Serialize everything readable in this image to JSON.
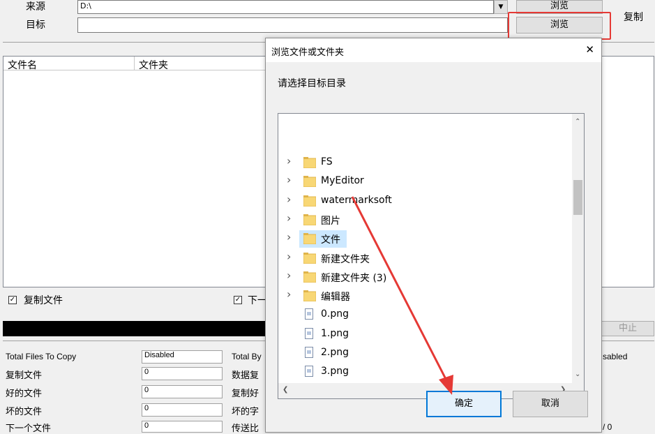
{
  "main": {
    "source_label": "来源",
    "source_value": "D:\\",
    "target_label": "目标",
    "target_value": "",
    "browse_source_label": "浏览",
    "browse_target_label": "浏览",
    "copy_label": "复制",
    "columns": [
      "文件名",
      "文件夹"
    ],
    "check_copy_files": "复制文件",
    "check_next": "下一",
    "stop_label": "中止",
    "stats_left": [
      {
        "label": "Total Files To Copy",
        "value": "Disabled"
      },
      {
        "label": "复制文件",
        "value": "0"
      },
      {
        "label": "好的文件",
        "value": "0"
      },
      {
        "label": "坏的文件",
        "value": "0"
      },
      {
        "label": "下一个文件",
        "value": "0"
      }
    ],
    "stats_mid": [
      "Total By",
      "数据复",
      "复制好",
      "坏的字",
      "传送比"
    ],
    "stats_right_top": "sabled",
    "stats_right_bottom": "/ 0"
  },
  "dialog": {
    "title": "浏览文件或文件夹",
    "close_glyph": "✕",
    "prompt": "请选择目标目录",
    "items": [
      {
        "name": "FS",
        "type": "folder"
      },
      {
        "name": "MyEditor",
        "type": "folder"
      },
      {
        "name": "watermarksoft",
        "type": "folder"
      },
      {
        "name": "图片",
        "type": "folder"
      },
      {
        "name": "文件",
        "type": "folder",
        "selected": true
      },
      {
        "name": "新建文件夹",
        "type": "folder"
      },
      {
        "name": "新建文件夹 (3)",
        "type": "folder"
      },
      {
        "name": "编辑器",
        "type": "folder"
      },
      {
        "name": "0.png",
        "type": "file"
      },
      {
        "name": "1.png",
        "type": "file"
      },
      {
        "name": "2.png",
        "type": "file"
      },
      {
        "name": "3.png",
        "type": "file"
      }
    ],
    "ok_label": "确定",
    "cancel_label": "取消"
  },
  "colors": {
    "highlight": "#e53935",
    "selection": "#cce8ff",
    "folder": "#f8d775"
  }
}
